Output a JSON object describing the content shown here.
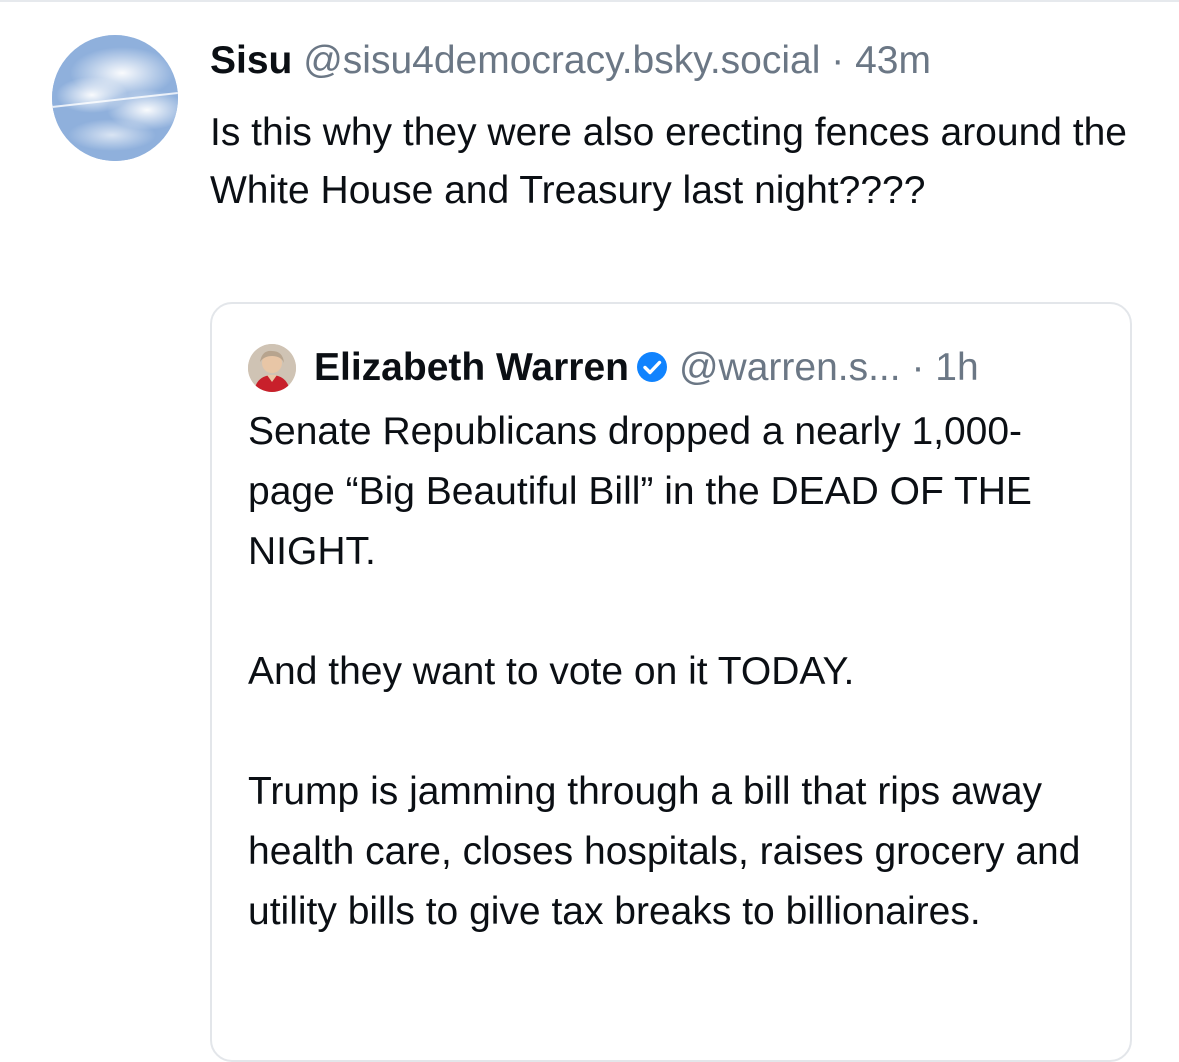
{
  "post": {
    "author_name": "Sisu",
    "author_handle": "@sisu4democracy.bsky.social",
    "separator": "·",
    "time": "43m",
    "avatar_icon": "sky-clouds-avatar",
    "text": "Is this why they were also erecting fences around the White House and Treasury last night????"
  },
  "quote": {
    "author_name": "Elizabeth Warren",
    "verified_icon": "verified-check-icon",
    "verified_color": "#1083fe",
    "author_handle": "@warren.s...",
    "separator": "·",
    "time": "1h",
    "avatar_icon": "portrait-avatar",
    "paragraphs": [
      "Senate Republicans dropped a nearly 1,000-page “Big Beautiful Bill” in the DEAD OF THE NIGHT.",
      "And they want to vote on it TODAY.",
      "Trump is jamming through a bill that rips away health care, closes hospitals, raises grocery and utility bills to give tax breaks to billionaires."
    ]
  },
  "colors": {
    "text": "#0b0f14",
    "muted": "#6b7785",
    "border": "#e3e6ea",
    "accent": "#1083fe"
  }
}
